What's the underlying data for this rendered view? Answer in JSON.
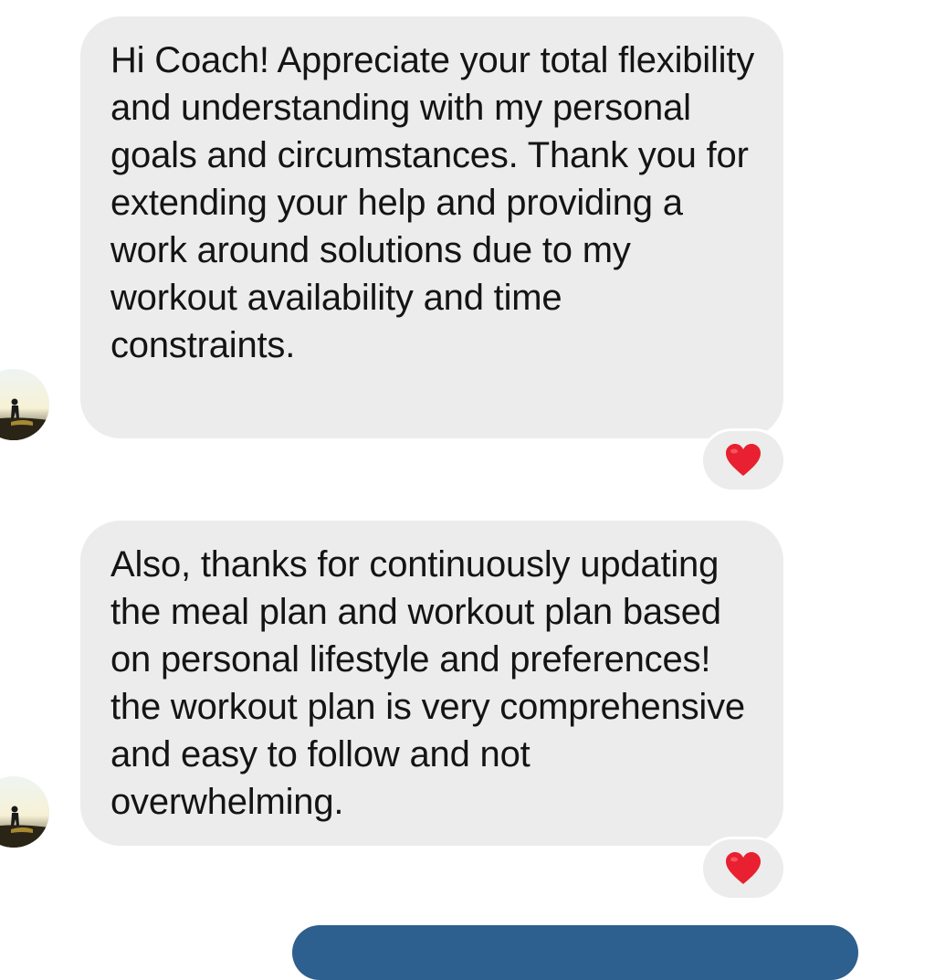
{
  "messages": [
    {
      "text": "Hi Coach! Appreciate your total flexibility and understanding with my personal goals and circumstances. Thank you for extending your help and providing a work around solutions due to my workout availability and time constraints.",
      "reaction": "heart-icon"
    },
    {
      "text": "Also, thanks for continuously updating the meal plan and workout plan based on personal lifestyle and preferences! the workout plan is very comprehensive and easy to follow and not overwhelming.",
      "reaction": "heart-icon"
    }
  ],
  "colors": {
    "incoming_bubble": "#ececec",
    "reaction_heart": "#e8202f",
    "outgoing_bubble": "#2d5f8f"
  }
}
